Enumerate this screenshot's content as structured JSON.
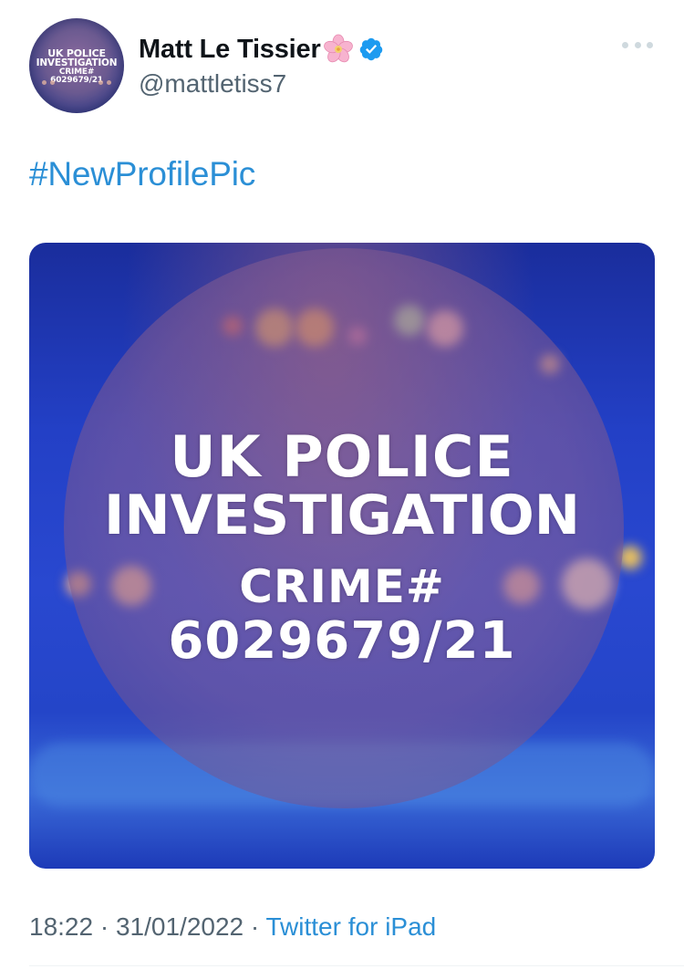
{
  "user": {
    "display_name": "Matt Le Tissier",
    "handle": "@mattletiss7",
    "verified": true,
    "name_emoji": "cherry-blossom-icon",
    "avatar_lines": [
      "UK POLICE",
      "INVESTIGATION",
      "CRIME#",
      "6029679/21"
    ]
  },
  "tweet": {
    "text": "#NewProfilePic"
  },
  "media": {
    "lines": [
      "UK POLICE",
      "INVESTIGATION",
      "CRIME#",
      "6029679/21"
    ]
  },
  "meta": {
    "time": "18:22",
    "separator1": "·",
    "date": "31/01/2022",
    "separator2": "·",
    "source": "Twitter for iPad"
  },
  "colors": {
    "link": "#2b8fd6",
    "secondary_text": "#536471",
    "verified_badge": "#1d9bf0"
  },
  "icons": {
    "more": "more-horizontal-icon",
    "verified": "verified-badge-icon",
    "flower": "cherry-blossom-icon"
  }
}
